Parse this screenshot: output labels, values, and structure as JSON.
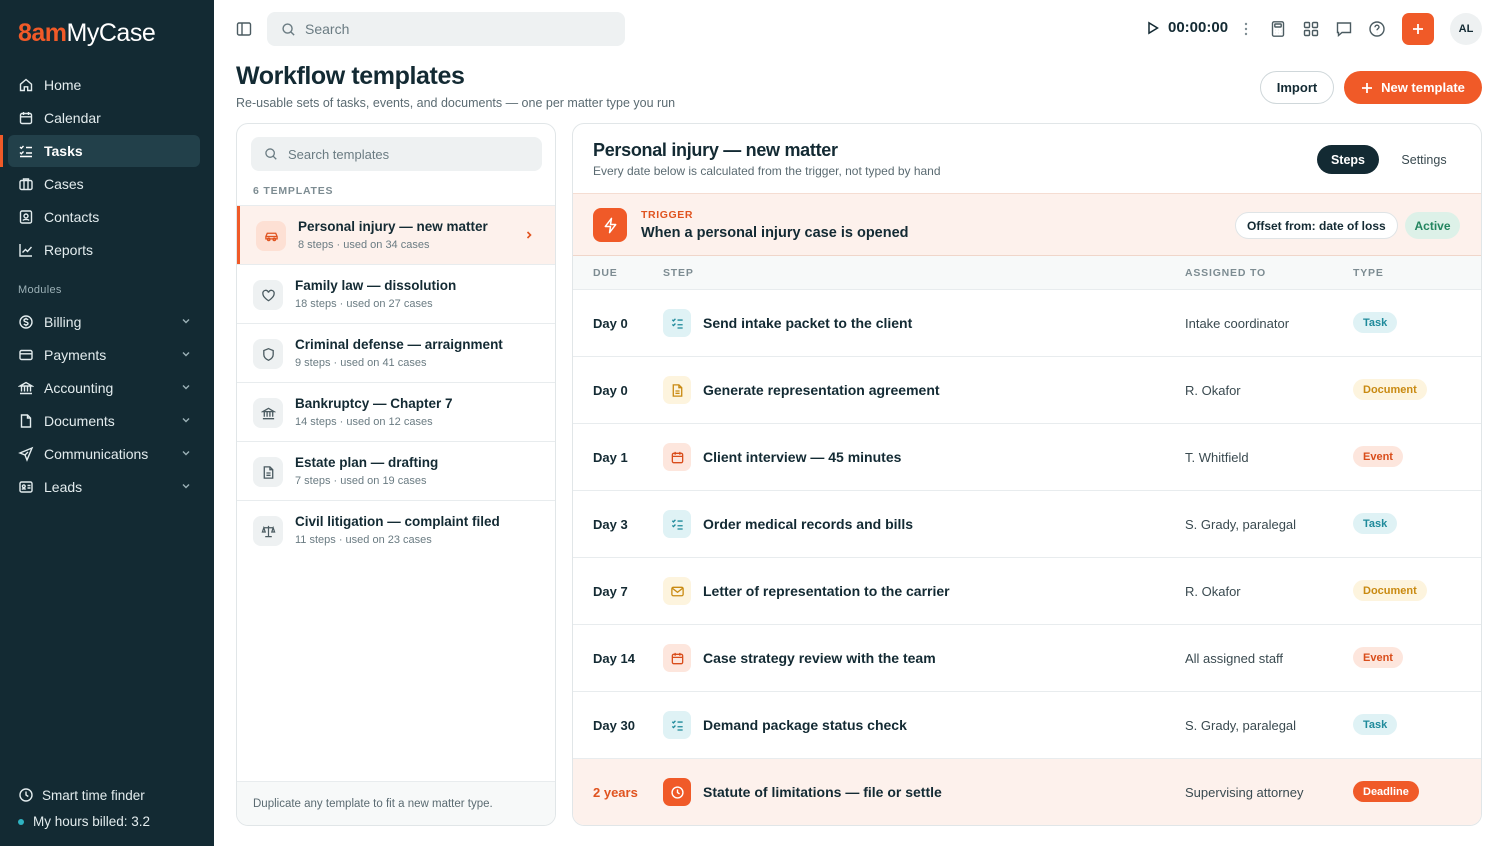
{
  "app": {
    "logo_prefix": "8am",
    "logo_name": "MyCase"
  },
  "sidebar": {
    "items": [
      {
        "label": "Home",
        "icon": "home-icon"
      },
      {
        "label": "Calendar",
        "icon": "calendar-icon"
      },
      {
        "label": "Tasks",
        "icon": "tasks-icon",
        "active": true
      },
      {
        "label": "Cases",
        "icon": "briefcase-icon"
      },
      {
        "label": "Contacts",
        "icon": "contacts-icon"
      },
      {
        "label": "Reports",
        "icon": "chart-icon"
      }
    ],
    "modules_label": "Modules",
    "modules": [
      {
        "label": "Billing",
        "icon": "dollar-icon"
      },
      {
        "label": "Payments",
        "icon": "card-icon"
      },
      {
        "label": "Accounting",
        "icon": "bank-icon"
      },
      {
        "label": "Documents",
        "icon": "document-icon"
      },
      {
        "label": "Communications",
        "icon": "send-icon"
      },
      {
        "label": "Leads",
        "icon": "id-card-icon"
      }
    ],
    "smart_time_finder": "Smart time finder",
    "hours_billed": "My hours billed: 3.2"
  },
  "topbar": {
    "search_placeholder": "Search",
    "timer": "00:00:00",
    "avatar_initials": "AL"
  },
  "page": {
    "title": "Workflow templates",
    "subtitle": "Re-usable sets of tasks, events, and documents — one per matter type you run",
    "import_label": "Import",
    "new_template_label": "New template"
  },
  "templates": {
    "search_placeholder": "Search templates",
    "count_label": "6 TEMPLATES",
    "items": [
      {
        "name": "Personal injury — new matter",
        "meta": "8 steps · used on 34 cases",
        "icon": "car-icon",
        "active": true
      },
      {
        "name": "Family law — dissolution",
        "meta": "18 steps · used on 27 cases",
        "icon": "heart-icon"
      },
      {
        "name": "Criminal defense — arraignment",
        "meta": "9 steps · used on 41 cases",
        "icon": "shield-icon"
      },
      {
        "name": "Bankruptcy — Chapter 7",
        "meta": "14 steps · used on 12 cases",
        "icon": "bank-icon"
      },
      {
        "name": "Estate plan — drafting",
        "meta": "7 steps · used on 19 cases",
        "icon": "document-icon"
      },
      {
        "name": "Civil litigation — complaint filed",
        "meta": "11 steps · used on 23 cases",
        "icon": "scales-icon"
      }
    ],
    "footer": "Duplicate any template to fit a new matter type."
  },
  "detail": {
    "title": "Personal injury — new matter",
    "subtitle": "Every date below is calculated from the trigger, not typed by hand",
    "tab_steps": "Steps",
    "tab_settings": "Settings",
    "trigger_label": "TRIGGER",
    "trigger_text": "When a personal injury case is opened",
    "offset": "Offset from: date of loss",
    "status": "Active",
    "columns": {
      "due": "DUE",
      "step": "STEP",
      "assigned": "ASSIGNED TO",
      "type": "TYPE"
    },
    "steps": [
      {
        "due": "Day 0",
        "step": "Send intake packet to the client",
        "assigned": "Intake coordinator",
        "type": "Task",
        "kind": "task"
      },
      {
        "due": "Day 0",
        "step": "Generate representation agreement",
        "assigned": "R. Okafor",
        "type": "Document",
        "kind": "doc"
      },
      {
        "due": "Day 1",
        "step": "Client interview — 45 minutes",
        "assigned": "T. Whitfield",
        "type": "Event",
        "kind": "event"
      },
      {
        "due": "Day 3",
        "step": "Order medical records and bills",
        "assigned": "S. Grady, paralegal",
        "type": "Task",
        "kind": "task"
      },
      {
        "due": "Day 7",
        "step": "Letter of representation to the carrier",
        "assigned": "R. Okafor",
        "type": "Document",
        "kind": "mail"
      },
      {
        "due": "Day 14",
        "step": "Case strategy review with the team",
        "assigned": "All assigned staff",
        "type": "Event",
        "kind": "event"
      },
      {
        "due": "Day 30",
        "step": "Demand package status check",
        "assigned": "S. Grady, paralegal",
        "type": "Task",
        "kind": "task"
      },
      {
        "due": "2 years",
        "step": "Statute of limitations — file or settle",
        "assigned": "Supervising attorney",
        "type": "Deadline",
        "kind": "deadline"
      }
    ]
  },
  "colors": {
    "accent": "#f05a28",
    "sidebar": "#132a33",
    "task": "#1f8a9b",
    "document": "#c98a12",
    "event": "#d94d1b",
    "active_status": "#23855f"
  }
}
